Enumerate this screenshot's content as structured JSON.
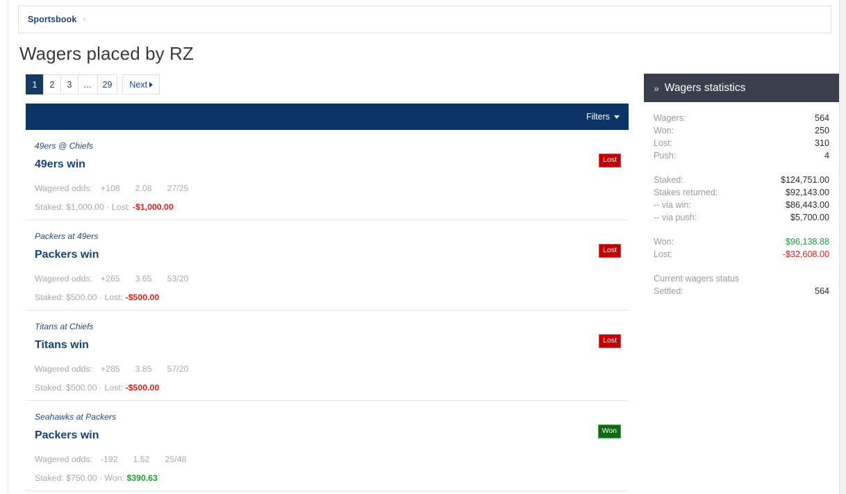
{
  "breadcrumb": {
    "items": [
      {
        "label": "Sportsbook",
        "separator": "›"
      }
    ]
  },
  "header": {
    "title": "Wagers placed by RZ"
  },
  "pagination": {
    "pages": [
      {
        "label": "1",
        "active": true
      },
      {
        "label": "2",
        "active": false
      },
      {
        "label": "3",
        "active": false
      },
      {
        "label": "…",
        "active": false
      },
      {
        "label": "29",
        "active": false
      }
    ],
    "next_label": "Next"
  },
  "filters": {
    "label": "Filters",
    "bar_color": "#0b3567"
  },
  "wagers": [
    {
      "event": "49ers @ Chiefs",
      "pick": "49ers win",
      "status": "Lost",
      "status_type": "lost",
      "odds_label": "Wagered odds:",
      "odds_american": "+108",
      "odds_decimal": "2.08",
      "odds_fractional": "27/25",
      "staked_label": "Staked:",
      "staked_amount": "$1,000.00",
      "separator": "·",
      "result_label": "Lost:",
      "result_amount": "-$1,000.00",
      "result_type": "neg"
    },
    {
      "event": "Packers at 49ers",
      "pick": "Packers win",
      "status": "Lost",
      "status_type": "lost",
      "odds_label": "Wagered odds:",
      "odds_american": "+265",
      "odds_decimal": "3.65",
      "odds_fractional": "53/20",
      "staked_label": "Staked:",
      "staked_amount": "$500.00",
      "separator": "·",
      "result_label": "Lost:",
      "result_amount": "-$500.00",
      "result_type": "neg"
    },
    {
      "event": "Titans at Chiefs",
      "pick": "Titans win",
      "status": "Lost",
      "status_type": "lost",
      "odds_label": "Wagered odds:",
      "odds_american": "+285",
      "odds_decimal": "3.85",
      "odds_fractional": "57/20",
      "staked_label": "Staked:",
      "staked_amount": "$500.00",
      "separator": "·",
      "result_label": "Lost:",
      "result_amount": "-$500.00",
      "result_type": "neg"
    },
    {
      "event": "Seahawks at Packers",
      "pick": "Packers win",
      "status": "Won",
      "status_type": "won",
      "odds_label": "Wagered odds:",
      "odds_american": "-192",
      "odds_decimal": "1.52",
      "odds_fractional": "25/48",
      "staked_label": "Staked:",
      "staked_amount": "$750.00",
      "separator": "·",
      "result_label": "Won:",
      "result_amount": "$390.63",
      "result_type": "pos"
    }
  ],
  "stats": {
    "title": "Wagers statistics",
    "chevron": "»",
    "groups": [
      {
        "rows": [
          {
            "label": "Wagers:",
            "value": "564",
            "type": "plain"
          },
          {
            "label": "Won:",
            "value": "250",
            "type": "plain"
          },
          {
            "label": "Lost:",
            "value": "310",
            "type": "plain"
          },
          {
            "label": "Push:",
            "value": "4",
            "type": "plain"
          }
        ]
      },
      {
        "rows": [
          {
            "label": "Staked:",
            "value": "$124,751.00",
            "type": "plain"
          },
          {
            "label": "Stakes returned:",
            "value": "$92,143.00",
            "type": "plain"
          },
          {
            "label": "-- via win:",
            "value": "$86,443.00",
            "type": "plain"
          },
          {
            "label": "-- via push:",
            "value": "$5,700.00",
            "type": "plain"
          }
        ]
      },
      {
        "rows": [
          {
            "label": "Won:",
            "value": "$96,138.88",
            "type": "pos"
          },
          {
            "label": "Lost:",
            "value": "-$32,608.00",
            "type": "neg"
          }
        ]
      }
    ],
    "current_status_heading": "Current wagers status",
    "current_status_rows": [
      {
        "label": "Settled:",
        "value": "564",
        "type": "plain"
      }
    ]
  }
}
